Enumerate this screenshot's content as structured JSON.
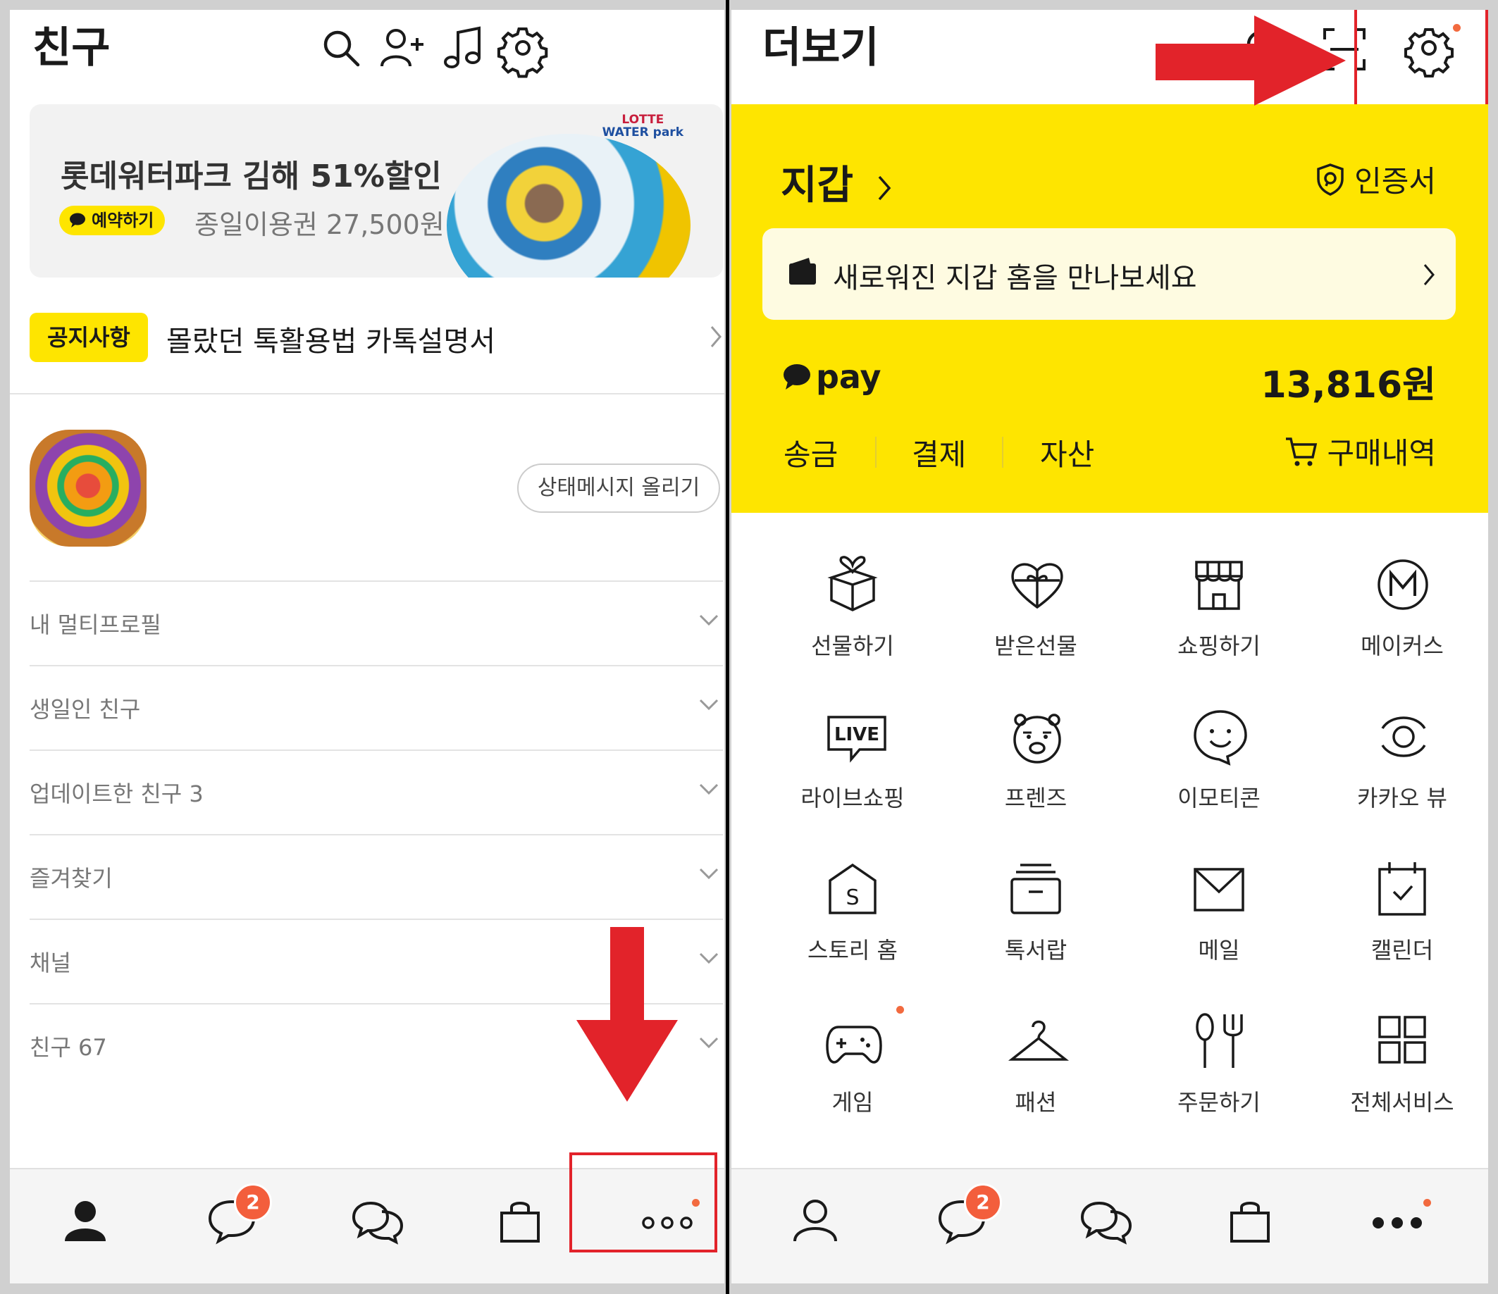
{
  "left": {
    "header": {
      "title": "친구"
    },
    "banner": {
      "title": "롯데워터파크 김해 51%할인",
      "pill_label": "예약하기",
      "subtitle": "종일이용권 27,500원",
      "logo_line1": "LOTTE",
      "logo_line2": "WATER park"
    },
    "notice": {
      "badge": "공지사항",
      "text": "몰랐던 톡활용법 카톡설명서"
    },
    "profile": {
      "status_button": "상태메시지 올리기"
    },
    "sections": [
      {
        "label": "내 멀티프로필"
      },
      {
        "label": "생일인 친구"
      },
      {
        "label": "업데이트한 친구 3"
      },
      {
        "label": "즐겨찾기"
      },
      {
        "label": "채널"
      },
      {
        "label": "친구 67"
      }
    ],
    "nav": {
      "chat_badge": "2"
    }
  },
  "right": {
    "header": {
      "title": "더보기"
    },
    "wallet": {
      "title": "지갑",
      "cert_label": "인증서",
      "promo": "새로워진 지갑 홈을 만나보세요",
      "pay_label": "pay",
      "amount": "13,816원",
      "actions": [
        "송금",
        "결제",
        "자산"
      ],
      "purchase_label": "구매내역"
    },
    "services": [
      {
        "label": "선물하기",
        "icon": "gift-box-icon"
      },
      {
        "label": "받은선물",
        "icon": "gift-heart-icon"
      },
      {
        "label": "쇼핑하기",
        "icon": "store-icon"
      },
      {
        "label": "메이커스",
        "icon": "makers-icon"
      },
      {
        "label": "라이브쇼핑",
        "icon": "live-icon"
      },
      {
        "label": "프렌즈",
        "icon": "friends-bear-icon"
      },
      {
        "label": "이모티콘",
        "icon": "emoticon-icon"
      },
      {
        "label": "카카오 뷰",
        "icon": "view-eye-icon"
      },
      {
        "label": "스토리 홈",
        "icon": "story-home-icon"
      },
      {
        "label": "톡서랍",
        "icon": "drawer-icon"
      },
      {
        "label": "메일",
        "icon": "mail-icon"
      },
      {
        "label": "캘린더",
        "icon": "calendar-icon"
      },
      {
        "label": "게임",
        "icon": "gamepad-icon"
      },
      {
        "label": "패션",
        "icon": "hanger-icon"
      },
      {
        "label": "주문하기",
        "icon": "fork-knife-icon"
      },
      {
        "label": "전체서비스",
        "icon": "grid-icon"
      }
    ],
    "nav": {
      "chat_badge": "2"
    }
  },
  "colors": {
    "accent": "#fee500",
    "badge": "#f35e3c",
    "highlight": "#e2232a"
  }
}
